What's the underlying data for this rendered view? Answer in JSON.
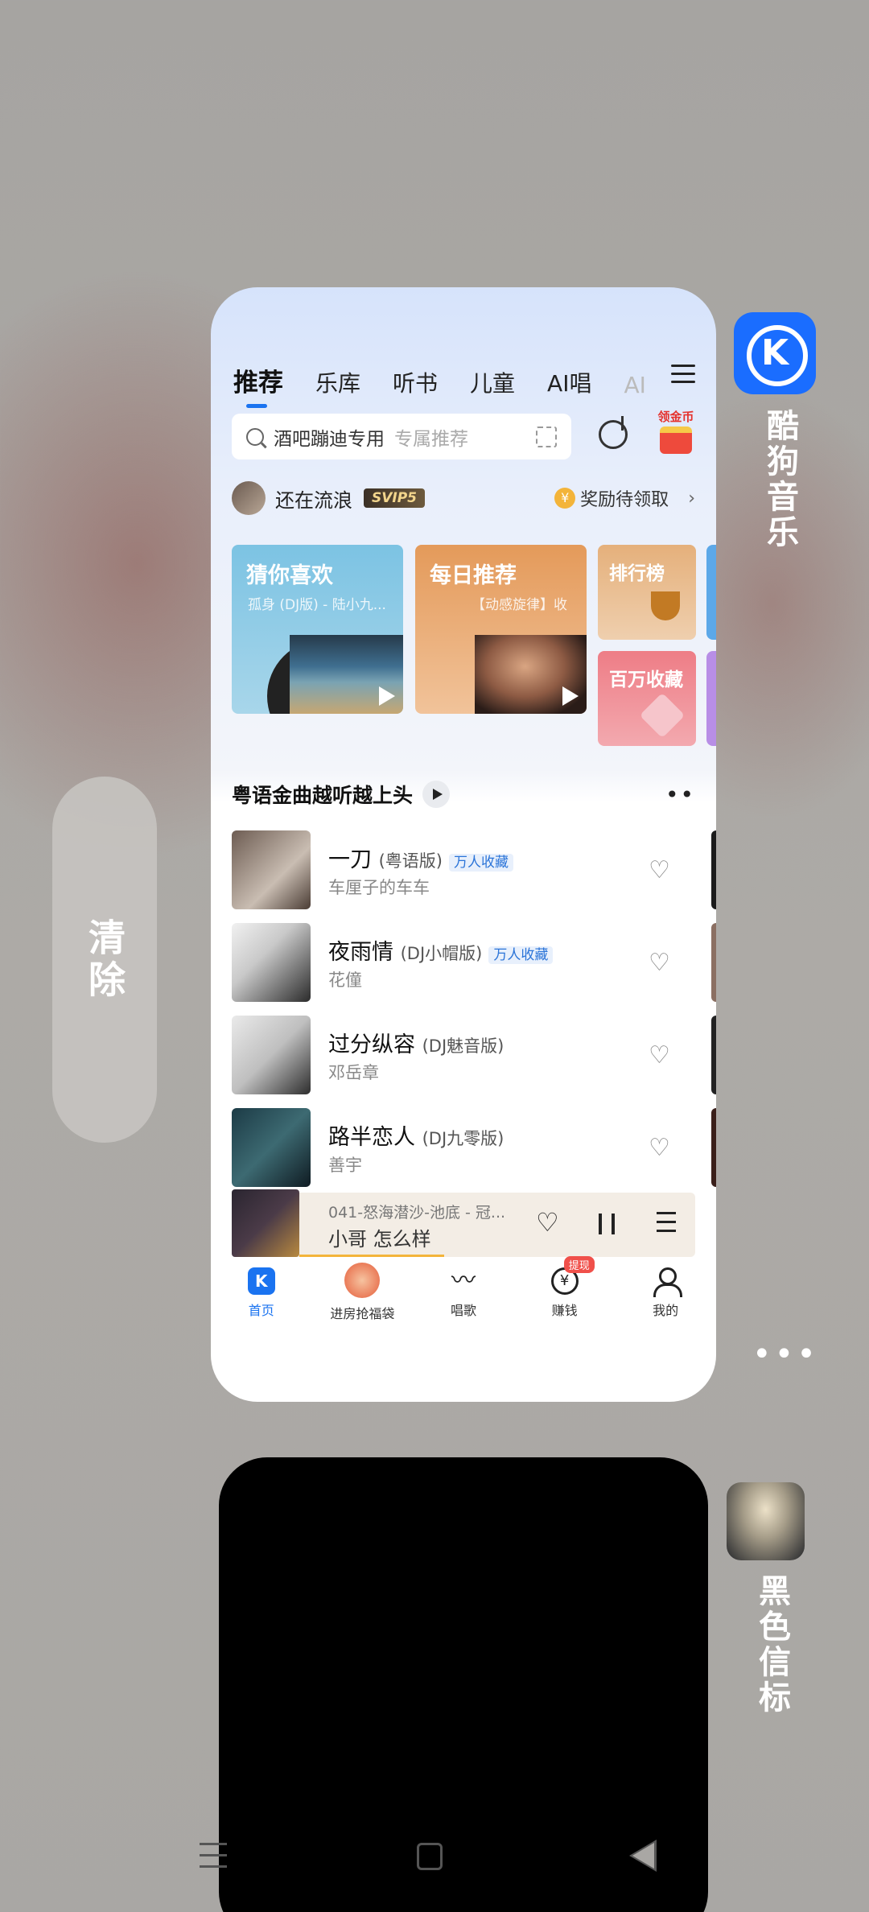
{
  "recents": {
    "clear_label": "清除",
    "more_label": "•••"
  },
  "apps": [
    {
      "name": "酷狗音乐",
      "icon": "kugou-icon"
    },
    {
      "name": "黑色信标",
      "icon": "game-icon"
    }
  ],
  "kugou": {
    "icon_letter": "K",
    "tabs": [
      "推荐",
      "乐库",
      "听书",
      "儿童",
      "AI唱",
      "AI"
    ],
    "search": {
      "query": "酒吧蹦迪专用",
      "hint": "专属推荐"
    },
    "coin_label": "领金币",
    "user": {
      "name": "还在流浪",
      "vip": "SVIP5"
    },
    "reward": {
      "label": "奖励待领取",
      "chevron": "›",
      "coin_symbol": "¥"
    },
    "tiles": [
      {
        "title": "猜你喜欢",
        "subtitle": "孤身 (DJ版) - 陆小九..."
      },
      {
        "title": "每日推荐",
        "subtitle": "【动感旋律】收"
      },
      {
        "title": "排行榜"
      },
      {
        "title": "百万收藏"
      }
    ],
    "section": {
      "title": "粤语金曲越听越上头",
      "more": "••"
    },
    "songs": [
      {
        "title": "一刀",
        "version": "(粤语版)",
        "badge": "万人收藏",
        "artist": "车厘子的车车"
      },
      {
        "title": "夜雨情",
        "version": "(DJ小帽版)",
        "badge": "万人收藏",
        "artist": "花僮"
      },
      {
        "title": "过分纵容",
        "version": "(DJ魅音版)",
        "badge": "",
        "artist": "邓岳章"
      },
      {
        "title": "路半恋人",
        "version": "(DJ九零版)",
        "badge": "",
        "artist": "善宇"
      }
    ],
    "player": {
      "track": "041-怒海潜沙-池底  -  冠...",
      "episode": "小哥 怎么样"
    },
    "bottom_nav": [
      {
        "label": "首页",
        "icon": "home-icon"
      },
      {
        "label": "进房抢福袋",
        "icon": "lucky-bag-icon"
      },
      {
        "label": "唱歌",
        "icon": "sing-icon"
      },
      {
        "label": "赚钱",
        "icon": "yen-icon",
        "badge": "提现"
      },
      {
        "label": "我的",
        "icon": "profile-icon"
      }
    ],
    "accent_color": "#1a73f0"
  },
  "system_nav": [
    "menu-icon",
    "home-icon",
    "back-icon"
  ]
}
